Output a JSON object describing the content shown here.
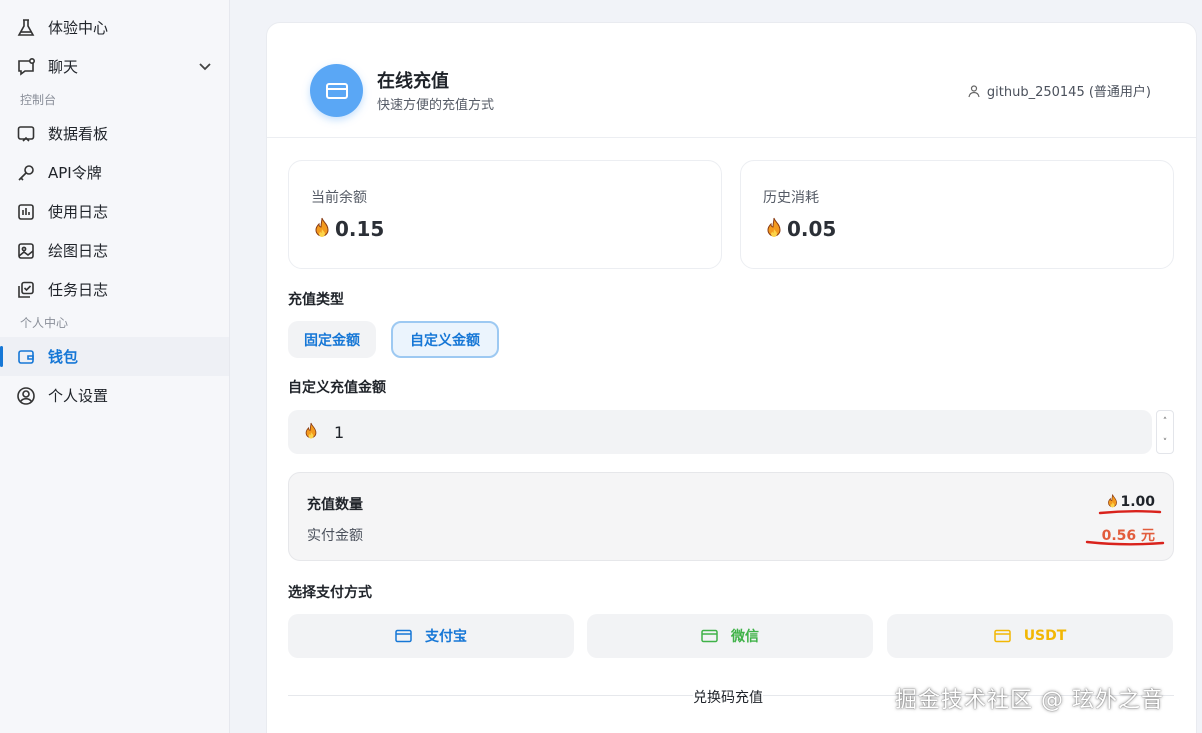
{
  "sidebar": {
    "items": [
      {
        "label": "体验中心",
        "icon": "flask-icon"
      },
      {
        "label": "聊天",
        "icon": "chat-icon"
      },
      {
        "label": "数据看板",
        "icon": "dashboard-icon"
      },
      {
        "label": "API令牌",
        "icon": "key-icon"
      },
      {
        "label": "使用日志",
        "icon": "log-icon"
      },
      {
        "label": "绘图日志",
        "icon": "image-icon"
      },
      {
        "label": "任务日志",
        "icon": "task-icon"
      },
      {
        "label": "钱包",
        "icon": "wallet-icon"
      },
      {
        "label": "个人设置",
        "icon": "user-settings-icon"
      }
    ],
    "sections": [
      "控制台",
      "个人中心"
    ]
  },
  "header": {
    "title": "在线充值",
    "subtitle": "快速方便的充值方式",
    "user": "github_250145 (普通用户)"
  },
  "stats": {
    "balance_label": "当前余额",
    "balance_value": "0.15",
    "consumed_label": "历史消耗",
    "consumed_value": "0.05"
  },
  "recharge": {
    "type_title": "充值类型",
    "type_fixed": "固定金额",
    "type_custom": "自定义金额",
    "custom_title": "自定义充值金额",
    "amount_value": "1"
  },
  "summary": {
    "qty_label": "充值数量",
    "qty_value": "1.00",
    "pay_label": "实付金额",
    "pay_value": "0.56 元"
  },
  "payment": {
    "title": "选择支付方式",
    "methods": [
      {
        "label": "支付宝",
        "color": "#1677d6"
      },
      {
        "label": "微信",
        "color": "#3fb248"
      },
      {
        "label": "USDT",
        "color": "#f2b705"
      }
    ]
  },
  "redeem_label": "兑换码充值",
  "watermark": "掘金技术社区 @ 玹外之音",
  "colors": {
    "accent": "#1677d6",
    "price": "#e25c3c",
    "annotation": "#d9221c"
  }
}
